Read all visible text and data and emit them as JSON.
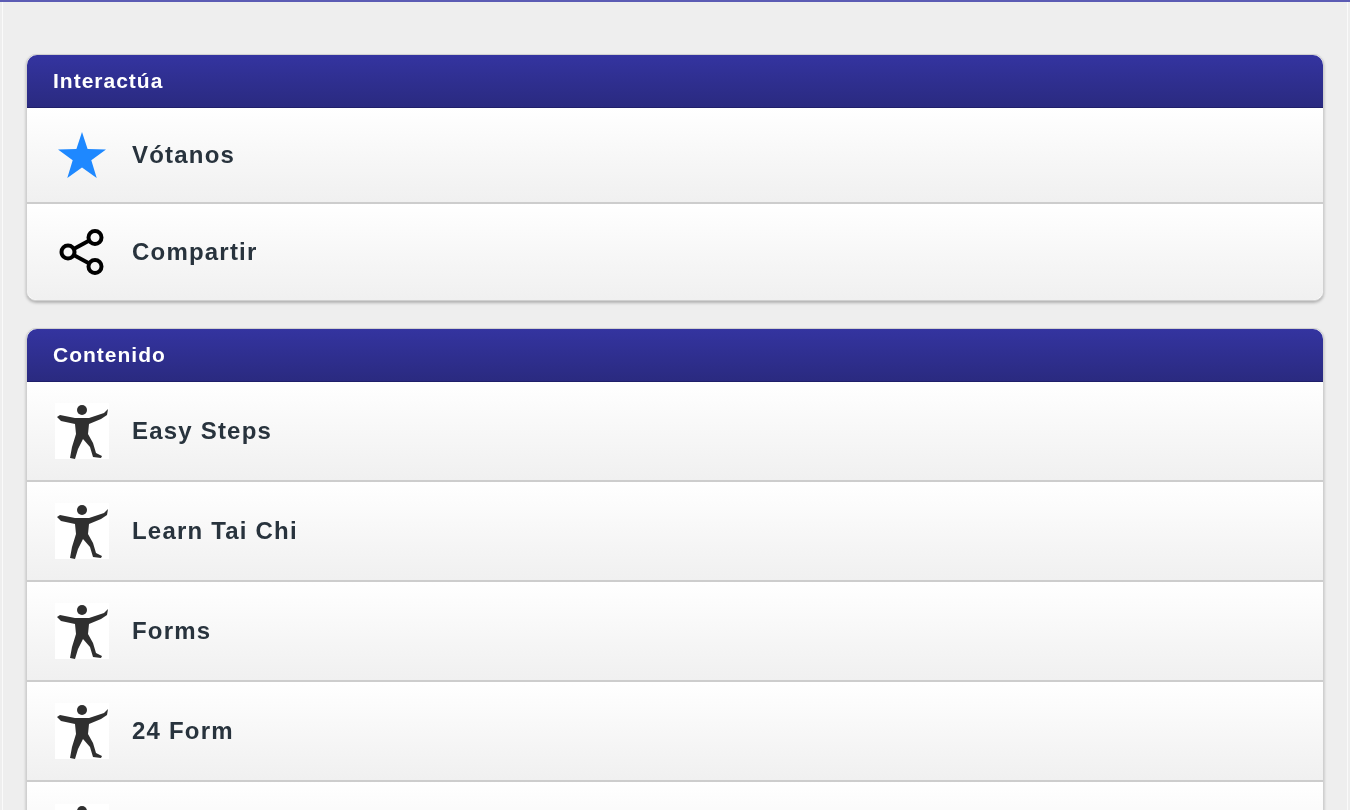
{
  "sections": [
    {
      "title": "Interactúa",
      "items": [
        {
          "kind": "star",
          "label": "Vótanos"
        },
        {
          "kind": "share",
          "label": "Compartir"
        }
      ]
    },
    {
      "title": "Contenido",
      "items": [
        {
          "kind": "figure",
          "label": "Easy Steps"
        },
        {
          "kind": "figure",
          "label": "Learn Tai Chi"
        },
        {
          "kind": "figure",
          "label": "Forms"
        },
        {
          "kind": "figure",
          "label": "24 Form"
        },
        {
          "kind": "figure"
        }
      ]
    }
  ]
}
